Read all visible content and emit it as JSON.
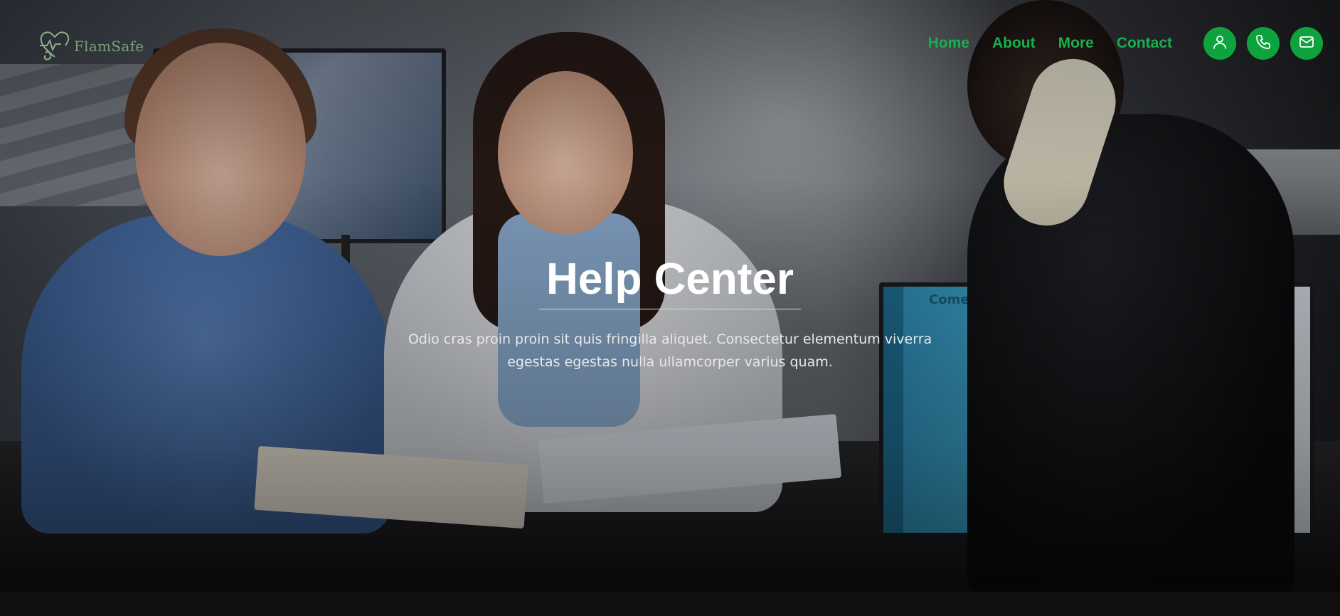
{
  "logo": {
    "text": "FlamSafe",
    "icon": "heart-pulse-icon",
    "color": "#7e9f78"
  },
  "nav": {
    "links": [
      {
        "label": "Home"
      },
      {
        "label": "About"
      },
      {
        "label": "More"
      },
      {
        "label": "Contact"
      }
    ],
    "icons": [
      "user-icon",
      "phone-icon",
      "mail-icon"
    ],
    "accent": "#0ea33e"
  },
  "hero": {
    "title": "Help Center",
    "subtitle": "Odio cras proin proin sit quis fringilla aliquet. Consectetur elementum viverra egestas egestas nulla ullamcorper varius quam."
  },
  "background_screen": {
    "brand": "Come"
  }
}
